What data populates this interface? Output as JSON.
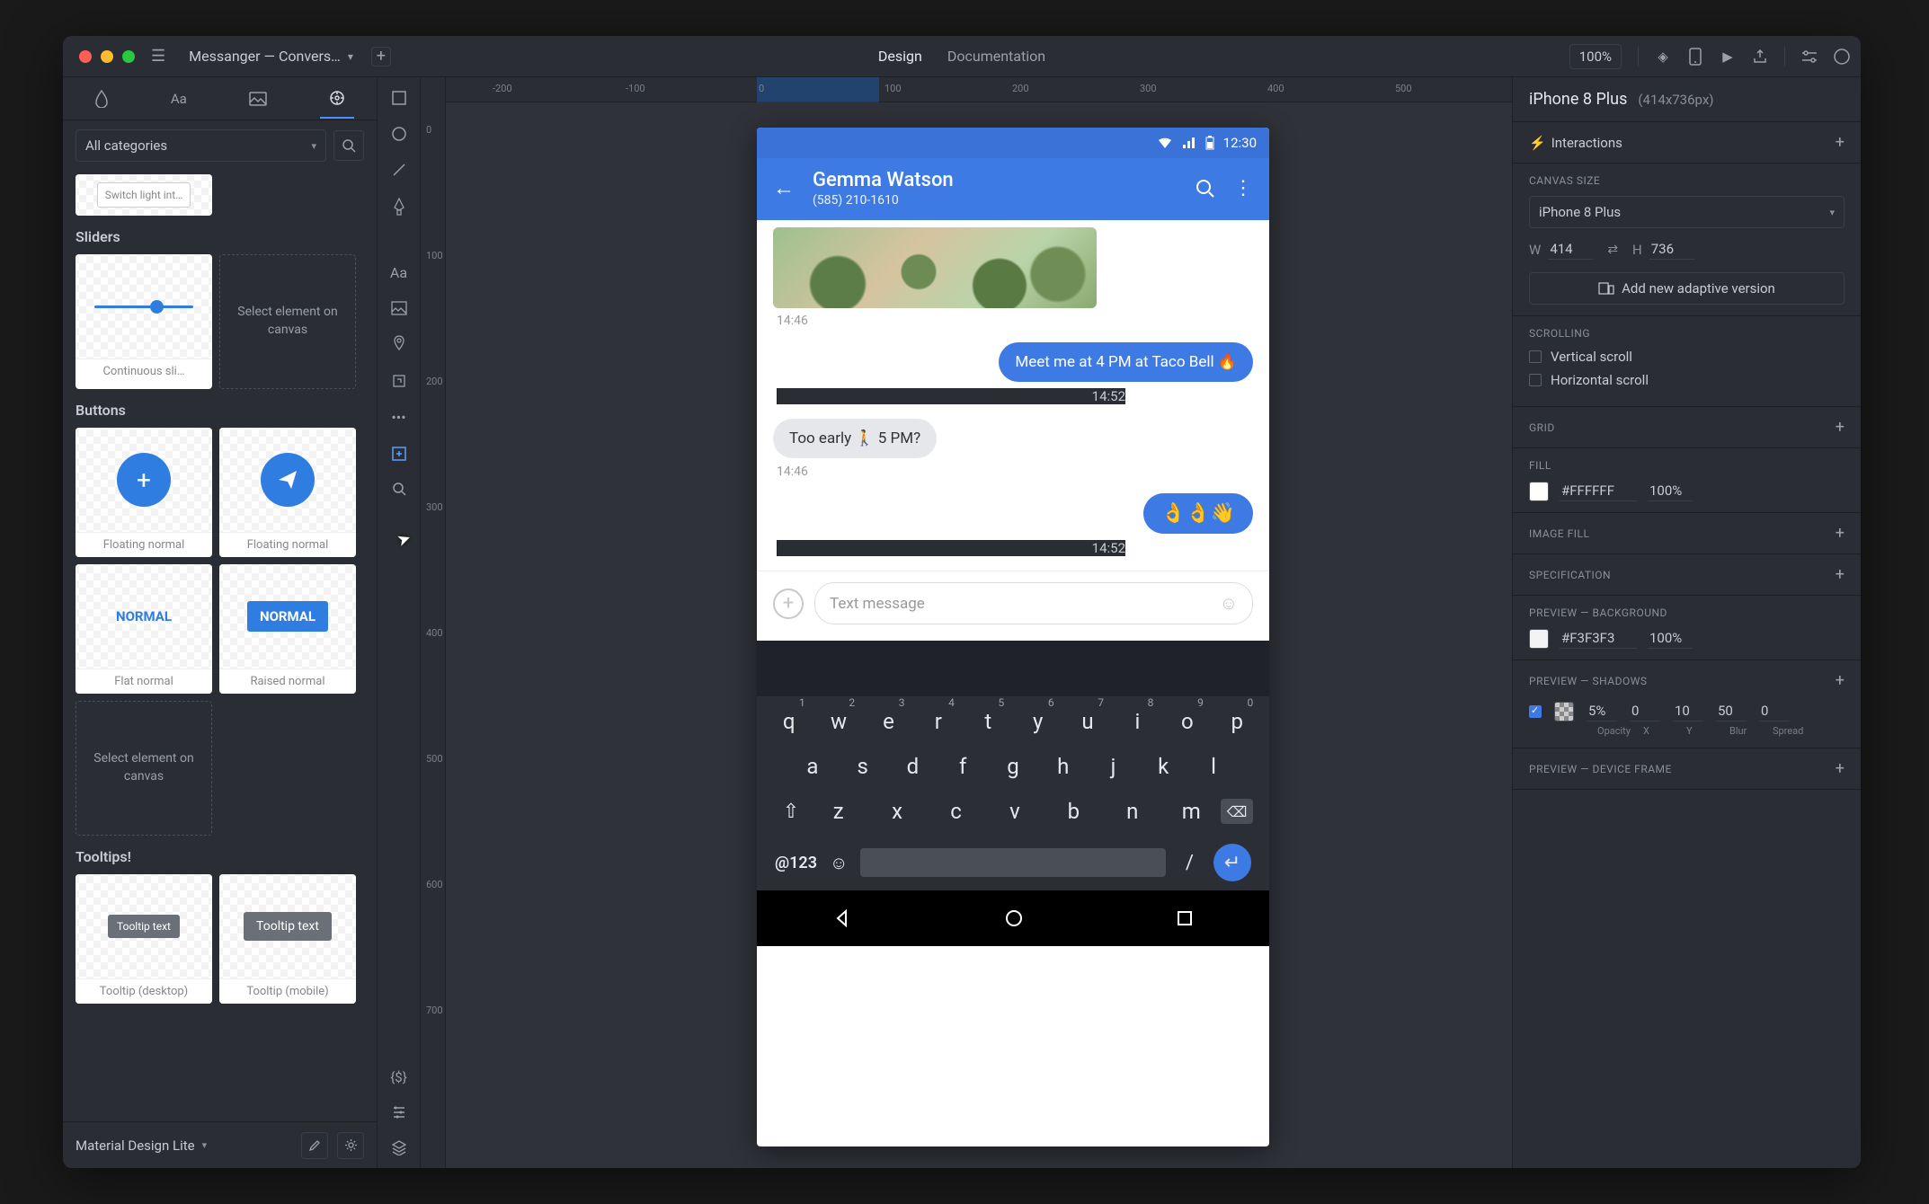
{
  "titlebar": {
    "project": "Messanger  —  Convers…",
    "tabs": {
      "design": "Design",
      "documentation": "Documentation"
    },
    "zoom": "100%"
  },
  "left": {
    "categories_label": "All categories",
    "switch_preview": "Switch light int…",
    "sections": {
      "sliders": "Sliders",
      "buttons": "Buttons",
      "tooltips": "Tooltips!"
    },
    "slider_label": "Continuous sli…",
    "select_hint": "Select element on canvas",
    "btn_floating": "Floating normal",
    "btn_flat": "Flat normal",
    "btn_raised": "Raised normal",
    "btn_normal": "NORMAL",
    "tooltip_chip": "Tooltip text",
    "tooltip_desktop": "Tooltip (desktop)",
    "tooltip_mobile": "Tooltip (mobile)",
    "footer_lib": "Material Design Lite"
  },
  "ruler_h": [
    "-200",
    "-100",
    "0",
    "100",
    "200",
    "300",
    "400",
    "500"
  ],
  "ruler_v": [
    "0",
    "100",
    "200",
    "300",
    "400",
    "500",
    "600",
    "700"
  ],
  "phone": {
    "status_time": "12:30",
    "contact_name": "Gemma Watson",
    "contact_phone": "(585) 210-1610",
    "msg1_ts": "14:46",
    "msg2": "Meet me at 4 PM at Taco Bell 🔥",
    "msg2_ts": "14:52",
    "msg3": "Too early 🚶  5 PM?",
    "msg3_ts": "14:46",
    "msg4": "👌👌👋",
    "msg4_ts": "14:52",
    "input_placeholder": "Text message",
    "kbd_sym": "@123",
    "kbd_slash": "/",
    "row1": [
      "q",
      "w",
      "e",
      "r",
      "t",
      "y",
      "u",
      "i",
      "o",
      "p"
    ],
    "row1n": [
      "1",
      "2",
      "3",
      "4",
      "5",
      "6",
      "7",
      "8",
      "9",
      "0"
    ],
    "row2": [
      "a",
      "s",
      "d",
      "f",
      "g",
      "h",
      "j",
      "k",
      "l"
    ],
    "row3": [
      "z",
      "x",
      "c",
      "v",
      "b",
      "n",
      "m"
    ]
  },
  "right": {
    "device": "iPhone 8 Plus",
    "device_dim": "(414x736px)",
    "interactions": "Interactions",
    "canvas_size": "CANVAS SIZE",
    "w": "414",
    "h": "736",
    "adaptive_btn": "Add new adaptive version",
    "scrolling": "SCROLLING",
    "v_scroll": "Vertical scroll",
    "h_scroll": "Horizontal scroll",
    "grid": "GRID",
    "fill": "FILL",
    "fill_hex": "#FFFFFF",
    "fill_pct": "100%",
    "image_fill": "IMAGE FILL",
    "specification": "SPECIFICATION",
    "preview_bg": "PREVIEW — BACKGROUND",
    "pbg_hex": "#F3F3F3",
    "pbg_pct": "100%",
    "preview_shadows": "PREVIEW — SHADOWS",
    "sh_opacity": "5%",
    "sh_x": "0",
    "sh_y": "10",
    "sh_blur": "50",
    "sh_spread": "0",
    "sh_l_op": "Opacity",
    "sh_l_x": "X",
    "sh_l_y": "Y",
    "sh_l_blur": "Blur",
    "sh_l_spread": "Spread",
    "preview_frame": "PREVIEW — DEVICE FRAME"
  }
}
